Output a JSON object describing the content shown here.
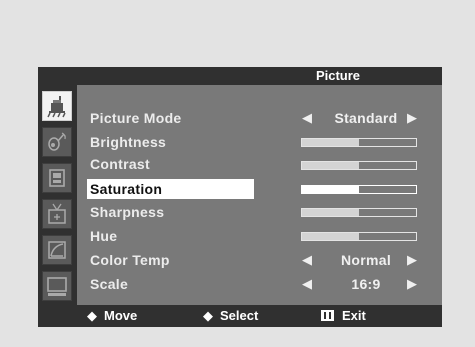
{
  "menu": {
    "title": "Picture",
    "items": [
      {
        "label": "Picture Mode",
        "value": "Standard"
      },
      {
        "label": "Brightness",
        "level": 0.5
      },
      {
        "label": "Contrast",
        "level": 0.5
      },
      {
        "label": "Saturation",
        "level": 0.5
      },
      {
        "label": "Sharpness",
        "level": 0.5
      },
      {
        "label": "Hue",
        "level": 0.5
      },
      {
        "label": "Color Temp",
        "value": "Normal"
      },
      {
        "label": "Scale",
        "value": "16:9"
      }
    ],
    "selected_index": 3
  },
  "sidebar_icons": [
    "picture-icon",
    "sound-icon",
    "setup-icon",
    "input-source-icon",
    "function-icon",
    "display-icon"
  ],
  "footer": {
    "move_glyph": "◆",
    "move_label": "Move",
    "select_glyph": "◆",
    "select_label": "Select",
    "exit_label": "Exit"
  },
  "colors": {
    "background": "#e3e3e3",
    "panel": "#797979",
    "bars": "#303030",
    "highlight": "#ffffff"
  }
}
